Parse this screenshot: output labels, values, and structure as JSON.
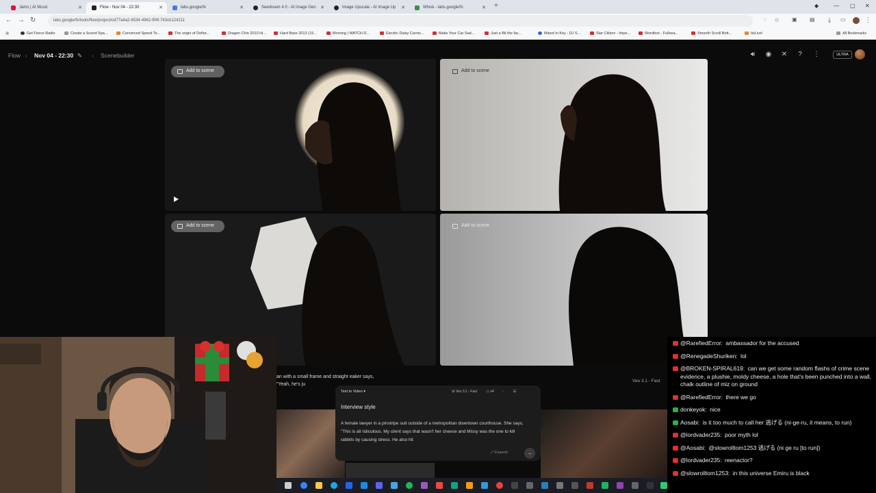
{
  "browser": {
    "tabs": [
      {
        "title": "Jams | AI Music",
        "color": "#d14",
        "active": false
      },
      {
        "title": "Flow - Nov 04 - 22:30",
        "color": "#222",
        "active": true
      },
      {
        "title": "labs.google/fx",
        "color": "#4a7bd8",
        "active": false
      },
      {
        "title": "Seedream 4.0 - AI Image Gen",
        "color": "#222",
        "active": false
      },
      {
        "title": "Image Upscale - AI Image Up",
        "color": "#222",
        "active": false
      },
      {
        "title": "Whisk - labs.google/fx",
        "color": "#3a8e4a",
        "active": false
      }
    ],
    "url": "labs.google/fx/tools/flow/project/cd77a4a2-6534-4962-9f4f-743cb124211",
    "bookmarks": [
      "Get Fierce Radio",
      "Create a Sound Spa...",
      "Convinced Speed Te...",
      "The origin of Deflor...",
      "Dragon Chin 2010 Hi...",
      "Hard Bass 2013 (19...",
      "Morning | WATCH D...",
      "Electric Daisy Carniv...",
      "Make Your Car Sad...",
      "Just a Bit the fac...",
      "Mixed In Key - DJ S...",
      "Star Citizen - Impe...",
      "Wordbox - Fullsea...",
      "Smooth Scroll Bott...",
      "ItsLive!"
    ],
    "all_bookmarks": "All Bookmarks"
  },
  "app": {
    "breadcrumb_root": "Flow",
    "project_title": "Nov 04 - 22:30",
    "breadcrumb_view": "Scenebuilder",
    "plan_badge": "ULTRA"
  },
  "tiles": {
    "add_label": "Add to scene"
  },
  "composer": {
    "caption": "an with a small frame and straight eaker says, \"Yeah, he's ju",
    "mode": "Text to Video",
    "model": "Veo 3.1 - Fast",
    "count": "x4",
    "prompt_title": "Interview style",
    "prompt_text": "A female lawyer in a pinstripe suit outside of a metropolitan downtown courthouse. She says, \"This is all ridiculous. My client says that wasn't her cheese and Missy was the one to kill rabbits by causing stress. He also hit",
    "expand": "Expand",
    "right_label": "Veo 3.1 - Fast"
  },
  "chat": [
    {
      "user": "@RarefiedError:",
      "text": "ambassador for the accused",
      "badge": "red"
    },
    {
      "user": "@RenegadeShuriken:",
      "text": "lol",
      "badge": "red"
    },
    {
      "user": "@BROKEN-SPIRAL619:",
      "text": "can we get some random flashs of crime scene evidence, a plushie, moldy cheese, a hole that's been punched into a wall, chalk outline of miz on ground",
      "badge": "red"
    },
    {
      "user": "@RarefiedError:",
      "text": "there we go",
      "badge": "red"
    },
    {
      "user": "donkeyok:",
      "text": "nice",
      "badge": "green"
    },
    {
      "user": "Aosabi:",
      "text": "is it too much to call her 逃げる (ni-ge-ru, it means, to run)",
      "badge": "green"
    },
    {
      "user": "@lordvader235:",
      "text": "poor myth lol",
      "badge": "red"
    },
    {
      "user": "@Aosabi:",
      "text": "@slowrolltom1253 逃げる (ni ge ru [to run])",
      "badge": "red"
    },
    {
      "user": "@lordvader235:",
      "text": "reenactor?",
      "badge": "red"
    },
    {
      "user": "@slowrolltom1253:",
      "text": "in this universe Emiru is black",
      "badge": "red"
    }
  ]
}
